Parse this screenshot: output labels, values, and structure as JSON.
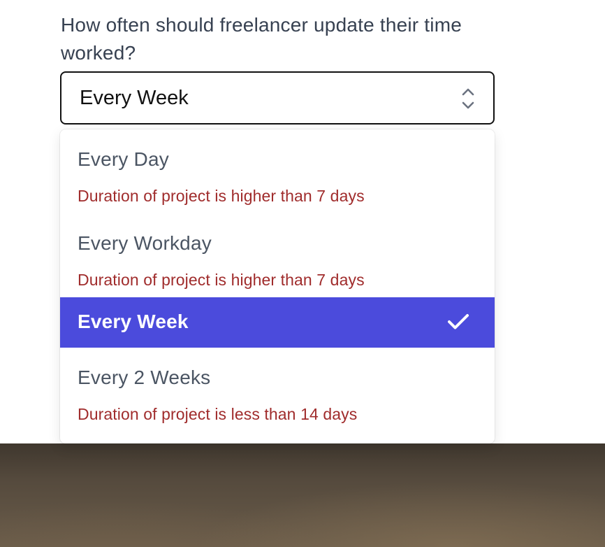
{
  "question": "How often should freelancer update their time worked?",
  "select": {
    "value": "Every Week",
    "icon": "chevron-up-down-icon"
  },
  "dropdown": {
    "options": [
      {
        "label": "Every Day",
        "note": "Duration of project is higher than 7 days",
        "selected": false
      },
      {
        "label": "Every Workday",
        "note": "Duration of project is higher than 7 days",
        "selected": false
      },
      {
        "label": "Every Week",
        "note": "",
        "selected": true,
        "icon": "check-icon"
      },
      {
        "label": "Every 2 Weeks",
        "note": "Duration of project is less than 14 days",
        "selected": false
      }
    ]
  },
  "colors": {
    "selected_bg": "#4b4bdc",
    "note_text": "#a02c2c",
    "question_text": "#374151"
  }
}
